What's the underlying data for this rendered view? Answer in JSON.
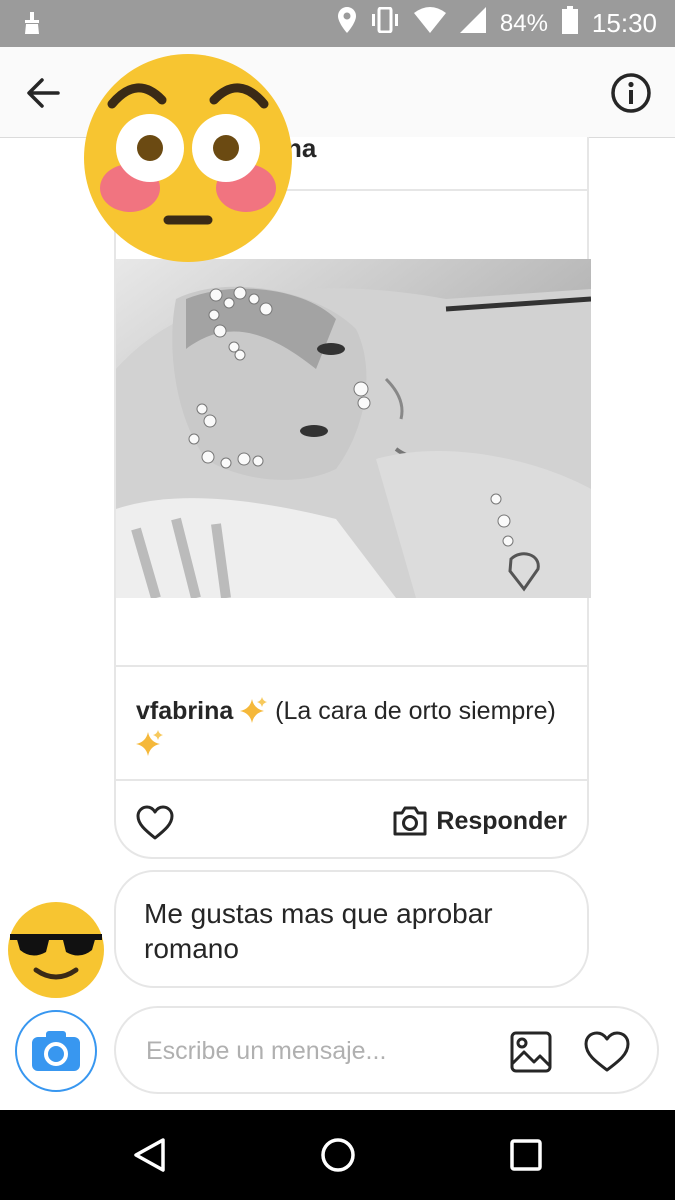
{
  "status_bar": {
    "battery": "84%",
    "time": "15:30"
  },
  "header": {
    "title_partial": "na"
  },
  "post": {
    "username": "vfabrina",
    "caption_text": "(La cara de orto siempre)",
    "reply_label": "Responder"
  },
  "message": {
    "text": "Me gustas mas que aprobar romano"
  },
  "composer": {
    "placeholder": "Escribe un mensaje..."
  },
  "colors": {
    "accent": "#3897f0",
    "status_bar": "#9b9b9b",
    "sparkle": "#f5b83a"
  },
  "icons": {
    "back": "arrow-left-icon",
    "info": "info-icon",
    "like": "heart-icon",
    "reply": "camera-icon",
    "gallery": "image-icon",
    "camera": "camera-icon"
  }
}
